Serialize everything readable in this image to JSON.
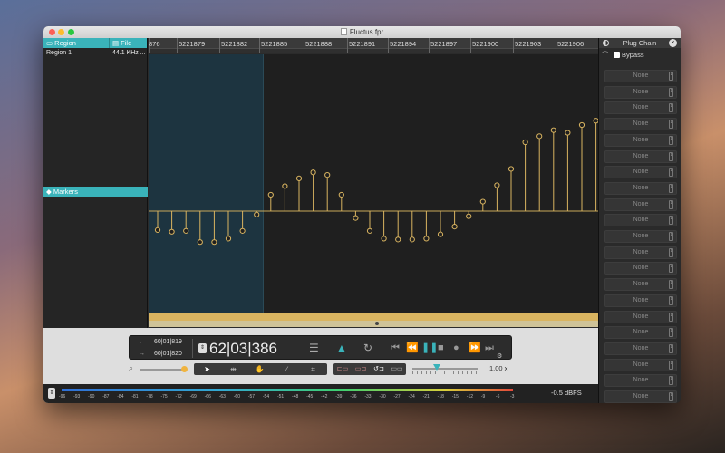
{
  "window": {
    "title": "Fluctus.fpr"
  },
  "regions_panel": {
    "col_region": "Region",
    "col_file": "File",
    "rows": [
      {
        "region": "Region 1",
        "file": "44.1 KHz ..."
      }
    ],
    "markers_label": "Markers"
  },
  "ruler": {
    "ticks": [
      "876",
      "5221879",
      "5221882",
      "5221885",
      "5221888",
      "5221891",
      "5221894",
      "5221897",
      "5221900",
      "5221903",
      "5221906"
    ]
  },
  "waveform": {
    "samples": [
      -0.22,
      -0.24,
      -0.23,
      -0.36,
      -0.36,
      -0.32,
      -0.23,
      -0.04,
      0.19,
      0.29,
      0.38,
      0.45,
      0.42,
      0.19,
      -0.08,
      -0.23,
      -0.32,
      -0.33,
      -0.33,
      -0.32,
      -0.27,
      -0.18,
      -0.06,
      0.11,
      0.3,
      0.49,
      0.8,
      0.87,
      0.94,
      0.91,
      1.0,
      1.05
    ],
    "color": "#d9b460",
    "selection_color": "#1d3440"
  },
  "plug_chain": {
    "title": "Plug Chain",
    "bypass_label": "Bypass",
    "slots": [
      "None",
      "None",
      "None",
      "None",
      "None",
      "None",
      "None",
      "None",
      "None",
      "None",
      "None",
      "None",
      "None",
      "None",
      "None",
      "None",
      "None",
      "None",
      "None",
      "None",
      "None"
    ]
  },
  "transport": {
    "start_time": "60|01|819",
    "end_time": "60|01|820",
    "main_time": "62|03|386",
    "speed": "1.00 x"
  },
  "meter": {
    "ticks": [
      "-96",
      "-93",
      "-90",
      "-87",
      "-84",
      "-81",
      "-78",
      "-75",
      "-72",
      "-69",
      "-66",
      "-63",
      "-60",
      "-57",
      "-54",
      "-51",
      "-48",
      "-45",
      "-42",
      "-39",
      "-36",
      "-33",
      "-30",
      "-27",
      "-24",
      "-21",
      "-18",
      "-15",
      "-12",
      "-9",
      "-6",
      "-3"
    ],
    "readout": "-0.5 dBFS"
  },
  "colors": {
    "accent": "#3ab3ba",
    "wave": "#d9b460",
    "play": "#3ab3ba"
  }
}
